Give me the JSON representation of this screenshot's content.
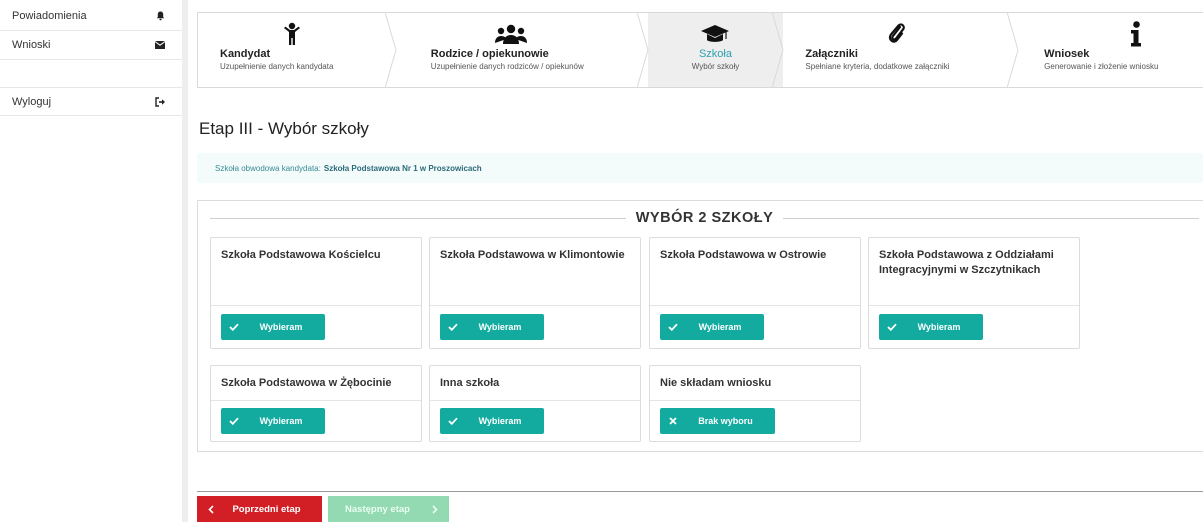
{
  "sidebar": {
    "items": [
      {
        "label": "Powiadomienia",
        "icon": "bell-icon"
      },
      {
        "label": "Wnioski",
        "icon": "envelope-icon"
      },
      {
        "label": "Wyloguj",
        "icon": "sign-out-icon"
      }
    ]
  },
  "steps": [
    {
      "title": "Kandydat",
      "subtitle": "Uzupełnienie danych kandydata",
      "icon": "child-icon"
    },
    {
      "title": "Rodzice / opiekunowie",
      "subtitle": "Uzupełnienie danych rodziców / opiekunów",
      "icon": "users-icon"
    },
    {
      "title": "Szkoła",
      "subtitle": "Wybór szkoły",
      "icon": "graduation-cap-icon",
      "active": true
    },
    {
      "title": "Załączniki",
      "subtitle": "Spełniane kryteria, dodatkowe załączniki",
      "icon": "paperclip-icon"
    },
    {
      "title": "Wniosek",
      "subtitle": "Generowanie i złożenie wniosku",
      "icon": "info-icon"
    }
  ],
  "page": {
    "title": "Etap III - Wybór szkoły",
    "info_label": "Szkoła obwodowa kandydata:",
    "info_value": "Szkoła Podstawowa Nr 1 w Proszowicach",
    "panel_title": "WYBÓR 2 SZKOŁY"
  },
  "schools": [
    {
      "name": "Szkoła Podstawowa Kościelcu",
      "button": "Wybieram"
    },
    {
      "name": "Szkoła Podstawowa w Klimontowie",
      "button": "Wybieram"
    },
    {
      "name": "Szkoła Podstawowa w Ostrowie",
      "button": "Wybieram"
    },
    {
      "name": "Szkoła Podstawowa z Oddziałami Integracyjnymi w Szczytnikach",
      "button": "Wybieram"
    },
    {
      "name": "Szkoła Podstawowa w Żębocinie",
      "button": "Wybieram"
    },
    {
      "name": "Inna szkoła",
      "button": "Wybieram"
    },
    {
      "name": "Nie składam wniosku",
      "button": "Brak wyboru"
    }
  ],
  "nav": {
    "prev_label": "Poprzedni etap",
    "next_label": "Następny etap"
  },
  "colors": {
    "accent": "#13aba0",
    "active_step": "#2ea0b0",
    "prev_button": "#d21f26",
    "next_button": "#93d9b1"
  }
}
